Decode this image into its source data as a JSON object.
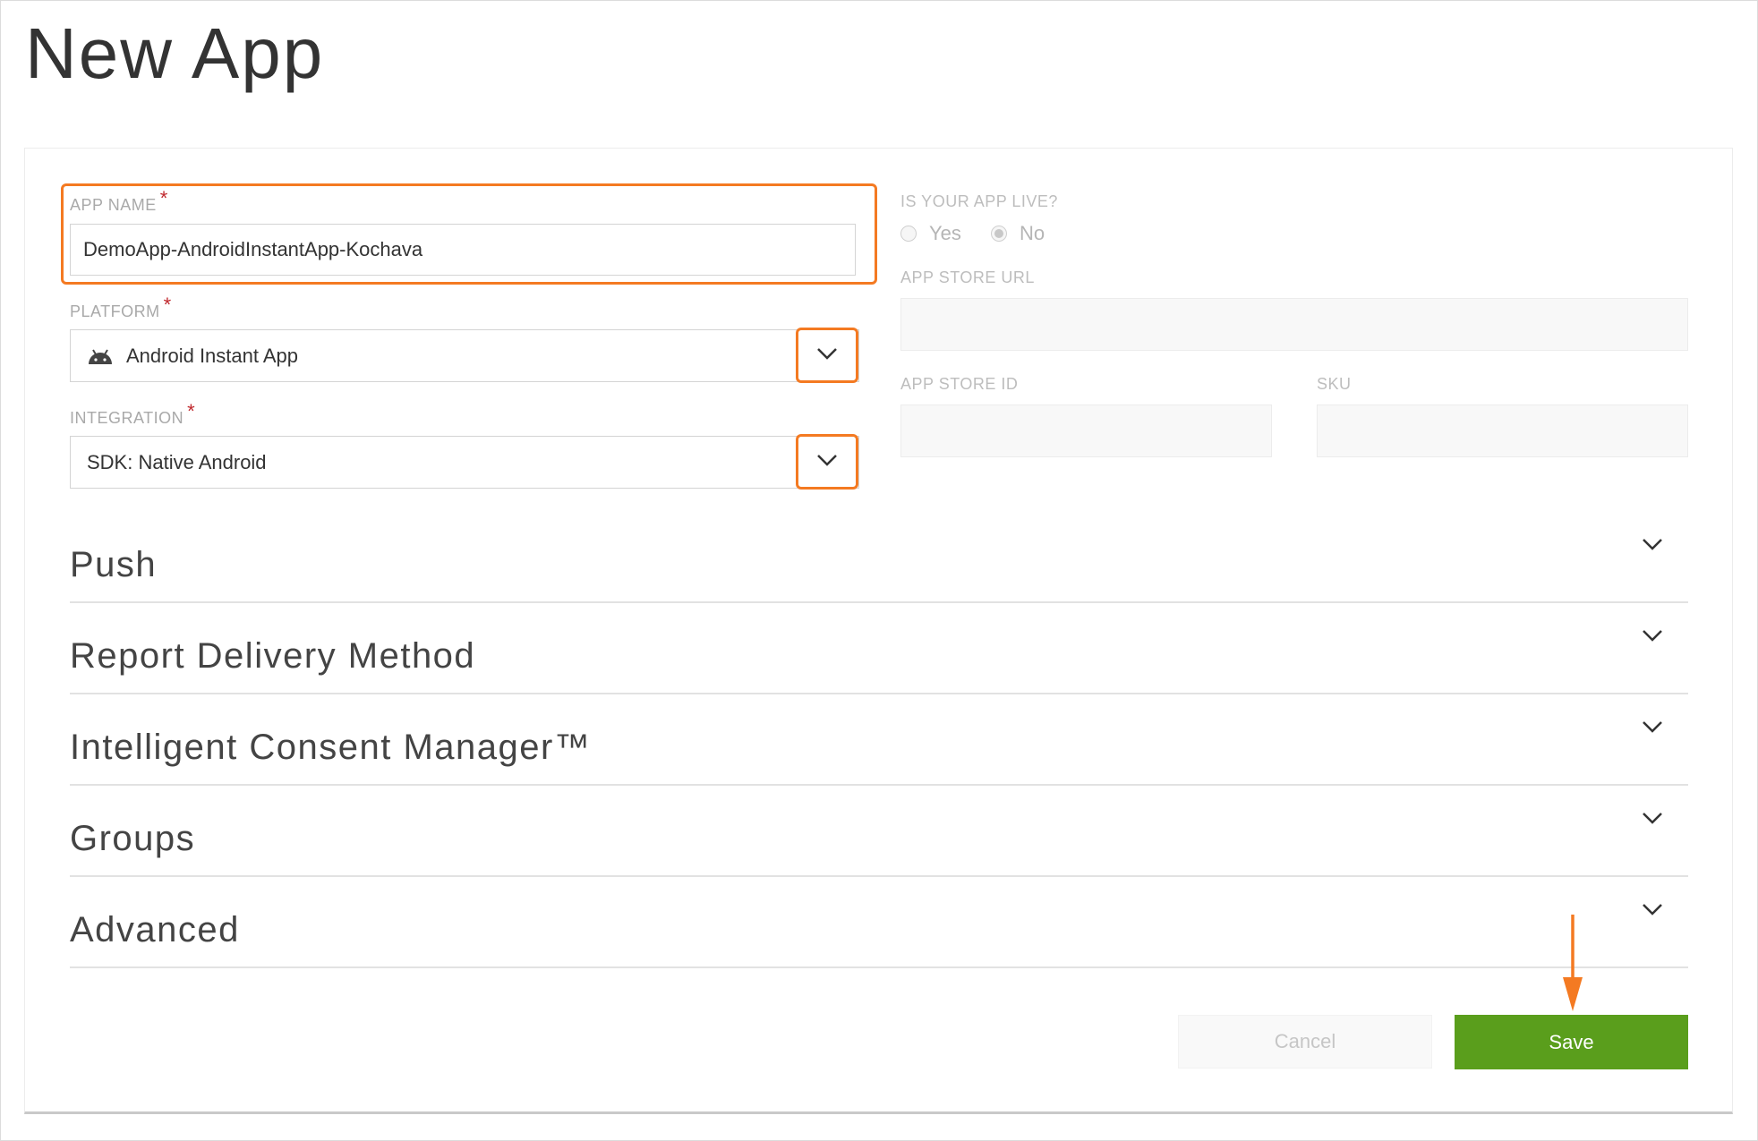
{
  "page": {
    "title": "New App"
  },
  "form": {
    "app_name": {
      "label": "APP NAME",
      "required_mark": "*",
      "value": "DemoApp-AndroidInstantApp-Kochava"
    },
    "platform": {
      "label": "PLATFORM",
      "required_mark": "*",
      "value": "Android Instant App",
      "icon": "android-icon"
    },
    "integration": {
      "label": "INTEGRATION",
      "required_mark": "*",
      "value": "SDK: Native Android"
    },
    "app_live": {
      "label": "IS YOUR APP LIVE?",
      "options": [
        "Yes",
        "No"
      ],
      "selected": "No"
    },
    "app_store_url": {
      "label": "APP STORE URL",
      "value": ""
    },
    "app_store_id": {
      "label": "APP STORE ID",
      "value": ""
    },
    "sku": {
      "label": "SKU",
      "value": ""
    }
  },
  "sections": [
    {
      "title": "Push"
    },
    {
      "title": "Report Delivery Method"
    },
    {
      "title": "Intelligent Consent Manager™"
    },
    {
      "title": "Groups"
    },
    {
      "title": "Advanced"
    }
  ],
  "actions": {
    "cancel_label": "Cancel",
    "save_label": "Save"
  },
  "colors": {
    "highlight": "#f47a22",
    "save": "#5a9e1c",
    "required": "#c0282d"
  }
}
